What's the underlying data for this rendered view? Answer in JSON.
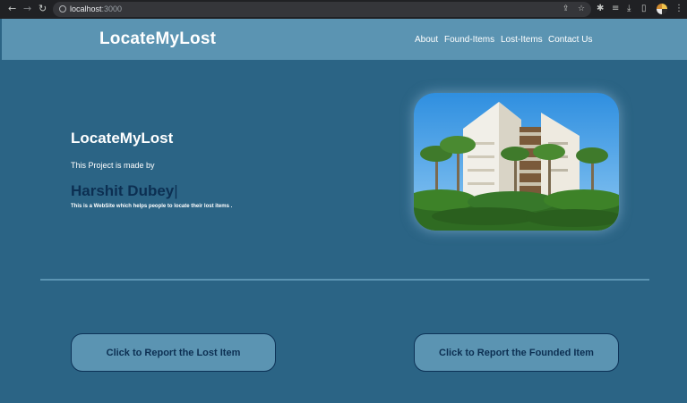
{
  "browser": {
    "url_host": "localhost",
    "url_port": ":3000",
    "back_icon": "arrow-left-icon",
    "forward_icon": "arrow-right-icon",
    "reload_icon": "reload-icon"
  },
  "header": {
    "brand": "LocateMyLost",
    "nav": [
      "About",
      "Found-Items",
      "Lost-Items",
      "Contact Us"
    ]
  },
  "hero": {
    "title": "LocateMyLost",
    "subtitle": "This Project is made by",
    "author": "Harshit Dubey",
    "description": "This is a WebSite which helps people to locate their lost items ."
  },
  "actions": {
    "report_lost": "Click to Report the Lost Item",
    "report_found": "Click to Report the Founded Item"
  },
  "colors": {
    "page_bg": "#2b6485",
    "header_bg": "#5b94b2",
    "accent_dark": "#0c2f52"
  }
}
